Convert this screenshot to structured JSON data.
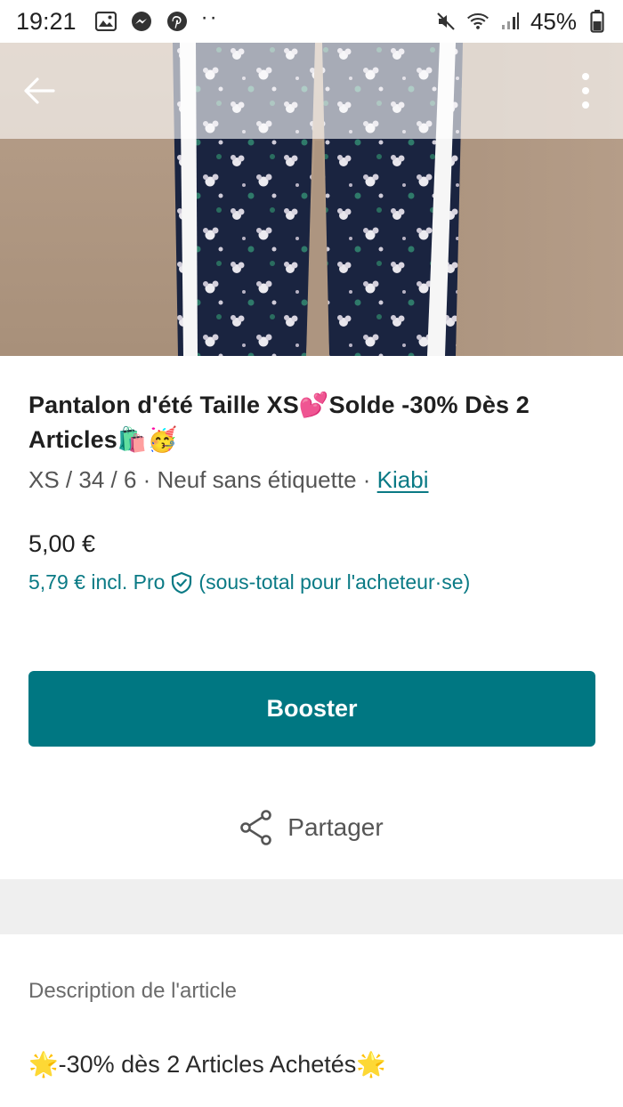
{
  "status_bar": {
    "time": "19:21",
    "notification_icons": [
      "gallery-icon",
      "messenger-icon",
      "pinterest-icon"
    ],
    "more_dots": "··",
    "battery_percent": "45%"
  },
  "top_bar": {
    "back_icon": "arrow-left-icon",
    "menu_icon": "more-vertical-icon"
  },
  "item": {
    "title_part1": "Pantalon d'été Taille XS",
    "title_emoji1": "💕",
    "title_part2": "Solde -30% Dès 2 Articles",
    "title_emoji2": "🛍️🥳",
    "size": "XS / 34 / 6",
    "separator": " · ",
    "condition": "Neuf sans étiquette",
    "brand": "Kiabi",
    "price": "5,00 €",
    "price_pro_amount": "5,79 € incl. Pro",
    "price_pro_note": "(sous-total pour l'acheteur·se)"
  },
  "actions": {
    "booster_label": "Booster",
    "share_label": "Partager"
  },
  "description": {
    "header": "Description de l'article",
    "emoji": "🌟",
    "text": "-30% dès 2 Articles Achetés"
  },
  "colors": {
    "accent": "#007782",
    "link": "#0a7a85"
  }
}
